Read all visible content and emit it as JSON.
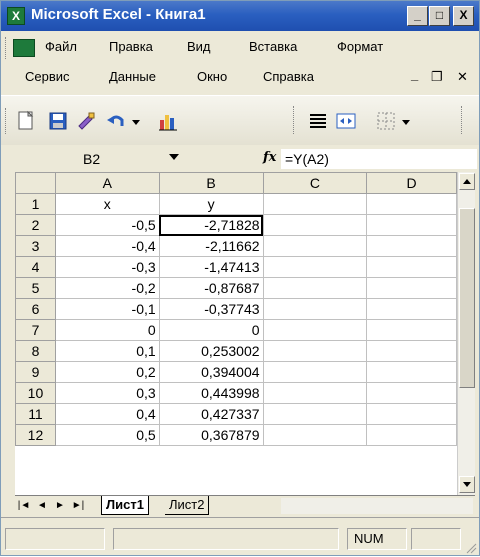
{
  "window": {
    "title": "Microsoft Excel - Книга1",
    "icon": "excel-icon"
  },
  "title_buttons": {
    "minimize": "_",
    "maximize": "□",
    "close": "X"
  },
  "menu": {
    "row1": [
      "Файл",
      "Правка",
      "Вид",
      "Вставка",
      "Формат"
    ],
    "row2": [
      "Сервис",
      "Данные",
      "Окно",
      "Справка"
    ],
    "doc_controls": {
      "minimize": "_",
      "restore": "❐",
      "close": "✕"
    }
  },
  "toolbar": {
    "icons": [
      "new-file-icon",
      "save-icon",
      "format-painter-icon",
      "undo-icon",
      "chart-wizard-icon",
      "align-icon",
      "merge-center-icon",
      "borders-icon"
    ]
  },
  "formula_bar": {
    "name_box": "B2",
    "fx_label": "fx",
    "formula": "=Y(A2)"
  },
  "grid": {
    "columns": [
      "A",
      "B",
      "C",
      "D"
    ],
    "rows": [
      {
        "n": "1",
        "a": "x",
        "b": "y"
      },
      {
        "n": "2",
        "a": "-0,5",
        "b": "-2,71828"
      },
      {
        "n": "3",
        "a": "-0,4",
        "b": "-2,11662"
      },
      {
        "n": "4",
        "a": "-0,3",
        "b": "-1,47413"
      },
      {
        "n": "5",
        "a": "-0,2",
        "b": "-0,87687"
      },
      {
        "n": "6",
        "a": "-0,1",
        "b": "-0,37743"
      },
      {
        "n": "7",
        "a": "0",
        "b": "0"
      },
      {
        "n": "8",
        "a": "0,1",
        "b": "0,253002"
      },
      {
        "n": "9",
        "a": "0,2",
        "b": "0,394004"
      },
      {
        "n": "10",
        "a": "0,3",
        "b": "0,443998"
      },
      {
        "n": "11",
        "a": "0,4",
        "b": "0,427337"
      },
      {
        "n": "12",
        "a": "0,5",
        "b": "0,367879"
      }
    ]
  },
  "sheets": {
    "tab1": "Лист1",
    "tab2": "Лист2"
  },
  "status": {
    "num": "NUM"
  }
}
